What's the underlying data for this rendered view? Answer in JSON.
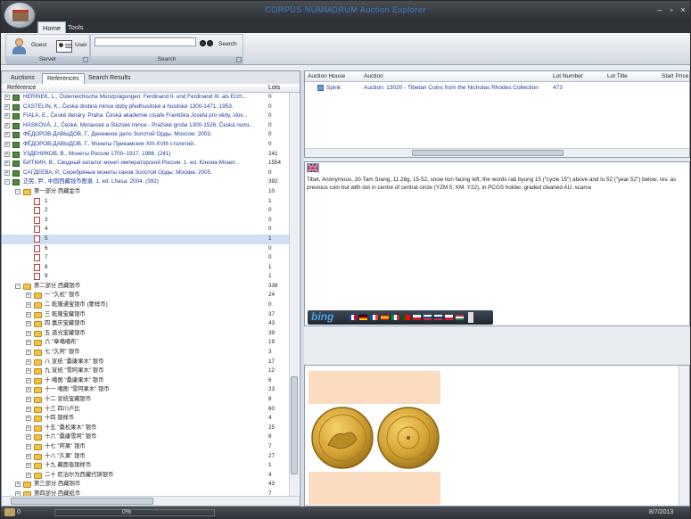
{
  "window": {
    "title": "CORPUS NUMMORUM Auction Explorer",
    "minimize": "–",
    "maximize": "▫",
    "close": "×"
  },
  "ribbon": {
    "tabs": [
      "Home",
      "Tools"
    ],
    "server_group": {
      "guest_label": "Guest",
      "user_label": "User",
      "label": "Server"
    },
    "search_group": {
      "search_value": "",
      "search_button": "Search",
      "label": "Search"
    }
  },
  "left_pane": {
    "tabs": [
      "Auctions",
      "References",
      "Search Results"
    ],
    "columns": {
      "reference": "Reference",
      "lots": "Lots"
    },
    "rows": [
      {
        "depth": 0,
        "icon": "book",
        "text": "HERINEK, L., Österreichische Münzprägungen: Ferdinand II. und Ferdinand III. als Erzh...",
        "lots": "0",
        "blue": true
      },
      {
        "depth": 0,
        "icon": "book",
        "text": "CASTELIN, K., Česká drobná mince doby předhusitské a husitské 1300-1471. 1953.",
        "lots": "0",
        "blue": true
      },
      {
        "depth": 0,
        "icon": "book",
        "text": "FIALA, E., České denáry. Praha: Česká akademie císaře Františka Josefa pro vědy, slov...",
        "lots": "0",
        "blue": true
      },
      {
        "depth": 0,
        "icon": "book",
        "text": "HÁSKOVÁ, J., České, Moravské a Slezské mince - Pražské groše 1300-1526. Česká numi...",
        "lots": "0",
        "blue": true
      },
      {
        "depth": 0,
        "icon": "book",
        "text": "ФЁДОРОВ-ДАВЫДОВ, Г., Денежное дело Золотой Орды. Moscow: 2003.",
        "lots": "0",
        "blue": true
      },
      {
        "depth": 0,
        "icon": "book",
        "text": "ФЁДОРОВ-ДАВЫДОВ, Г., Монеты Прикамских XIII-XVIII столетий..",
        "lots": "0",
        "blue": true
      },
      {
        "depth": 0,
        "icon": "book",
        "text": "УЗДЕНИКОВ, В., Монеты России 1700–1917. 1986. (241)",
        "lots": "241",
        "blue": true
      },
      {
        "depth": 0,
        "icon": "book",
        "text": "БИТКИН, В., Сводный каталог монет императорской России. 1. ed. Юнона-Монет...",
        "lots": "1554",
        "blue": true
      },
      {
        "depth": 0,
        "icon": "book",
        "text": "САГДЕЕВА, Р., Серебряные монеты ханов Золотой Орды. Москва: 2005.",
        "lots": "0",
        "blue": true
      },
      {
        "depth": 0,
        "icon": "book",
        "text": "正民, 尹., 中国西藏钱币图录. 1. ed. Lhasa: 2004. (392)",
        "lots": "392",
        "blue": true,
        "open": true
      },
      {
        "depth": 1,
        "icon": "folder",
        "text": "第一部分 西藏金币",
        "lots": "10",
        "open": true
      },
      {
        "depth": 2,
        "icon": "page",
        "text": "1",
        "lots": "1"
      },
      {
        "depth": 2,
        "icon": "page",
        "text": "2",
        "lots": "0"
      },
      {
        "depth": 2,
        "icon": "page",
        "text": "3",
        "lots": "0"
      },
      {
        "depth": 2,
        "icon": "page",
        "text": "4",
        "lots": "0"
      },
      {
        "depth": 2,
        "icon": "page",
        "text": "5",
        "lots": "1",
        "sel": true
      },
      {
        "depth": 2,
        "icon": "page",
        "text": "6",
        "lots": "0"
      },
      {
        "depth": 2,
        "icon": "page",
        "text": "7",
        "lots": "0"
      },
      {
        "depth": 2,
        "icon": "page",
        "text": "8",
        "lots": "1"
      },
      {
        "depth": 2,
        "icon": "page",
        "text": "9",
        "lots": "1"
      },
      {
        "depth": 1,
        "icon": "folder",
        "text": "第二部分 西藏银币",
        "lots": "338",
        "open": true
      },
      {
        "depth": 2,
        "icon": "folder",
        "text": "一 \"久松\" 银币",
        "lots": "24"
      },
      {
        "depth": 2,
        "icon": "folder",
        "text": "二 乾隆通宝银币 (蒙样币)",
        "lots": "0"
      },
      {
        "depth": 2,
        "icon": "folder",
        "text": "三 乾隆宝藏银币",
        "lots": "37"
      },
      {
        "depth": 2,
        "icon": "folder",
        "text": "四 嘉庆宝藏银币",
        "lots": "43"
      },
      {
        "depth": 2,
        "icon": "folder",
        "text": "五 道光宝藏银币",
        "lots": "39"
      },
      {
        "depth": 2,
        "icon": "folder",
        "text": "六 \"章噶噶布\"",
        "lots": "19"
      },
      {
        "depth": 2,
        "icon": "folder",
        "text": "七 \"久阿\" 银币",
        "lots": "3"
      },
      {
        "depth": 2,
        "icon": "folder",
        "text": "八 宣统 \"桑康果木\" 银币",
        "lots": "17"
      },
      {
        "depth": 2,
        "icon": "folder",
        "text": "九 宣统 \"雪阿果木\" 银币",
        "lots": "12"
      },
      {
        "depth": 2,
        "icon": "folder",
        "text": "十 噶图 \"桑康果木\" 银币",
        "lots": "6"
      },
      {
        "depth": 2,
        "icon": "folder",
        "text": "十一 噶图 \"雪阿果木\" 银币",
        "lots": "23"
      },
      {
        "depth": 2,
        "icon": "folder",
        "text": "十二 宣统宝藏银币",
        "lots": "8"
      },
      {
        "depth": 2,
        "icon": "folder",
        "text": "十三 四川卢比",
        "lots": "60"
      },
      {
        "depth": 2,
        "icon": "folder",
        "text": "十四 银样币",
        "lots": "4"
      },
      {
        "depth": 2,
        "icon": "folder",
        "text": "十五 \"桑松果木\" 银币",
        "lots": "25"
      },
      {
        "depth": 2,
        "icon": "folder",
        "text": "十六 \"桑康雪阿\" 银币",
        "lots": "8"
      },
      {
        "depth": 2,
        "icon": "folder",
        "text": "十七 \"阿果\" 银币",
        "lots": "7"
      },
      {
        "depth": 2,
        "icon": "folder",
        "text": "十八 \"久果\" 银币",
        "lots": "27"
      },
      {
        "depth": 2,
        "icon": "folder",
        "text": "十九 藏面值银样币",
        "lots": "1"
      },
      {
        "depth": 2,
        "icon": "folder",
        "text": "二十 尼泊尔为西藏代铸银币",
        "lots": "4"
      },
      {
        "depth": 1,
        "icon": "folder",
        "text": "第三部分 西藏铜币",
        "lots": "43"
      },
      {
        "depth": 1,
        "icon": "folder",
        "text": "第四部分 西藏纸币",
        "lots": "7"
      }
    ]
  },
  "lots_grid": {
    "columns": [
      "Auction House",
      "Auction",
      "Lot Number",
      "Lot Title",
      "Start Price"
    ],
    "rows": [
      {
        "house": "Spink",
        "auction": "Auction: 13020 - Tibetan Coins from the Nicholas Rhodes Collection",
        "lot": "473",
        "title": "",
        "price": ""
      }
    ]
  },
  "description": {
    "text": "Tibet, Anonymous, 20-Tam Srang, 11.28g, 15-52, snow lion facing left, the words rab byung 15 (\"cycle 15\") above and lo 52 (\"year 52\") below, rev. as previous coin but with dot in centre of central circle (YZM 5; KM. Y22), in PCGS holder, graded cleaned AU, scarce"
  },
  "bing": {
    "logo": "bing"
  },
  "status": {
    "progress": "0%",
    "progress_value": 0,
    "date": "8/7/2013"
  }
}
